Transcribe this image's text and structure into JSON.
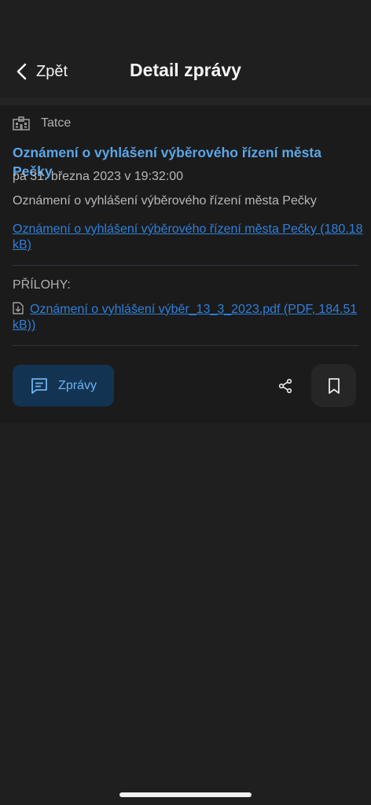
{
  "header": {
    "back_label": "Zpět",
    "title": "Detail zprávy"
  },
  "message": {
    "source_icon": "school-building-icon",
    "source": "Tatce",
    "title": "Oznámení o vyhlášení výběrového řízení města Pečky",
    "date": "pá 31. března 2023 v 19:32:00",
    "body": "Oznámení o vyhlášení výběrového řízení města Pečky",
    "link": "Oznámení o vyhlášení výběrového řízení města Pečky (180.18 kB)"
  },
  "attachments": {
    "heading": "PŘÍLOHY:",
    "items": [
      {
        "icon": "file-download-icon",
        "label": "Oznámení o vyhlášení výběr_13_3_2023.pdf (PDF, 184.51 kB))"
      }
    ]
  },
  "actions": {
    "messages_label": "Zprávy",
    "messages_icon": "chat-bubble-icon",
    "share_icon": "share-icon",
    "bookmark_icon": "bookmark-icon"
  },
  "colors": {
    "background": "#1f1f1f",
    "card": "#1b1b1b",
    "accent_title": "#5aa6e8",
    "link": "#2f7fd9",
    "button_bg": "#123452"
  }
}
